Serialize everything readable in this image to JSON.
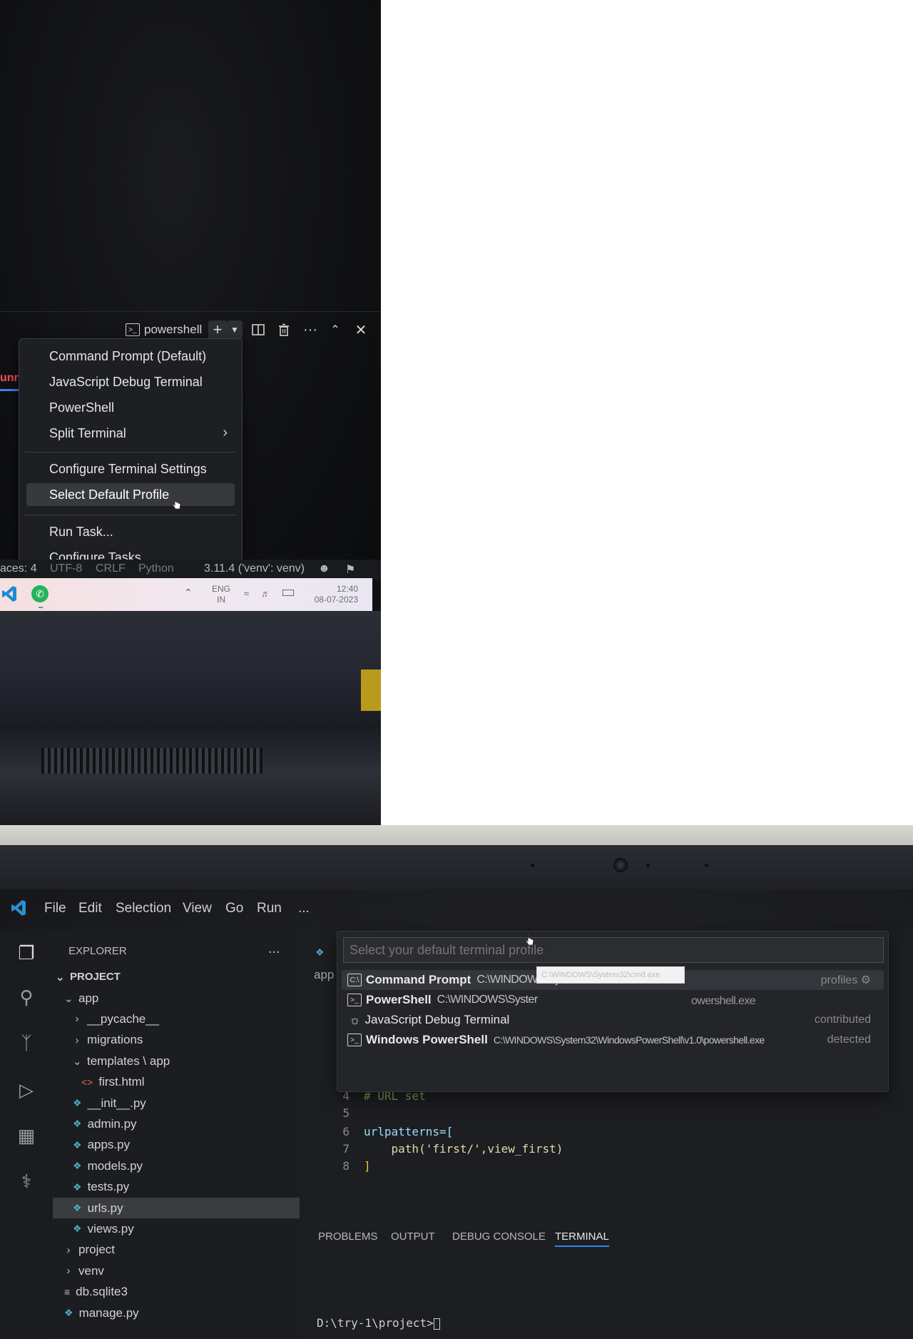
{
  "photo1": {
    "terminal_bar": {
      "terminal_name": "powershell",
      "new_terminal_icon": "plus-icon",
      "dropdown_icon": "chevron-down-icon",
      "split_icon": "split-editor-icon",
      "kill_icon": "trash-icon",
      "more_icon": "ellipsis-icon",
      "maximize_icon": "chevron-up-icon",
      "close_icon": "close-icon"
    },
    "left_edge_text": "unn",
    "menu": {
      "items": [
        {
          "label": "Command Prompt (Default)"
        },
        {
          "label": "JavaScript Debug Terminal"
        },
        {
          "label": "PowerShell"
        },
        {
          "label": "Split Terminal",
          "submenu": true
        },
        {
          "label": "Configure Terminal Settings"
        },
        {
          "label": "Select Default Profile",
          "highlighted": true
        },
        {
          "label": "Run Task..."
        },
        {
          "label": "Configure Tasks..."
        }
      ]
    },
    "statusbar": {
      "spaces": "aces: 4",
      "encoding": "UTF-8",
      "eol": "CRLF",
      "language": "Python",
      "interpreter": "3.11.4 ('venv': venv)"
    },
    "taskbar": {
      "lang_top": "ENG",
      "lang_bottom": "IN",
      "time": "12:40",
      "date": "08-07-2023"
    }
  },
  "photo2": {
    "menubar": [
      "File",
      "Edit",
      "Selection",
      "View",
      "Go",
      "Run",
      "..."
    ],
    "explorer": {
      "title": "EXPLORER",
      "more": "...",
      "project": "PROJECT",
      "tree": [
        {
          "label": "app",
          "type": "folder-open",
          "depth": 1
        },
        {
          "label": "__pycache__",
          "type": "folder",
          "depth": 2
        },
        {
          "label": "migrations",
          "type": "folder",
          "depth": 2
        },
        {
          "label": "templates \\ app",
          "type": "folder-open",
          "depth": 2
        },
        {
          "label": "first.html",
          "type": "html",
          "depth": 3
        },
        {
          "label": "__init__.py",
          "type": "py",
          "depth": 2
        },
        {
          "label": "admin.py",
          "type": "py",
          "depth": 2
        },
        {
          "label": "apps.py",
          "type": "py",
          "depth": 2
        },
        {
          "label": "models.py",
          "type": "py",
          "depth": 2
        },
        {
          "label": "tests.py",
          "type": "py",
          "depth": 2
        },
        {
          "label": "urls.py",
          "type": "py",
          "depth": 2,
          "selected": true
        },
        {
          "label": "views.py",
          "type": "py",
          "depth": 2
        },
        {
          "label": "project",
          "type": "folder",
          "depth": 1
        },
        {
          "label": "venv",
          "type": "folder",
          "depth": 1
        },
        {
          "label": "db.sqlite3",
          "type": "db",
          "depth": 1
        },
        {
          "label": "manage.py",
          "type": "py",
          "depth": 1
        }
      ]
    },
    "editor_tab_fragment": "app",
    "picker": {
      "placeholder": "Select your default terminal profile",
      "options": [
        {
          "name": "Command Prompt",
          "path": "C:\\WINDOWS\\System32\\cmd.exe",
          "right": "profiles",
          "icon": "terminal-cmd-icon"
        },
        {
          "name": "PowerShell",
          "path": "C:\\WINDOWS\\Syster",
          "right": "",
          "icon": "terminal-powershell-icon",
          "path_tail": "owershell.exe"
        },
        {
          "name": "JavaScript Debug Terminal",
          "path": "",
          "right": "contributed",
          "icon": "debug-icon"
        },
        {
          "name": "Windows PowerShell",
          "path": "C:\\WINDOWS\\System32\\WindowsPowerShell\\v1.0\\powershell.exe",
          "right": "detected",
          "icon": "terminal-powershell-icon"
        }
      ],
      "tooltip": "C:\\WINDOWS\\System32\\cmd.exe"
    },
    "code": {
      "lines": [
        {
          "n": "4",
          "text": "# URL set"
        },
        {
          "n": "5",
          "text": ""
        },
        {
          "n": "6",
          "text": "urlpatterns=["
        },
        {
          "n": "7",
          "text": "    path('first/',view_first)"
        },
        {
          "n": "8",
          "text": "]"
        }
      ]
    },
    "panel_tabs": [
      "PROBLEMS",
      "OUTPUT",
      "DEBUG CONSOLE",
      "TERMINAL"
    ],
    "terminal_prompt": "D:\\try-1\\project>"
  }
}
